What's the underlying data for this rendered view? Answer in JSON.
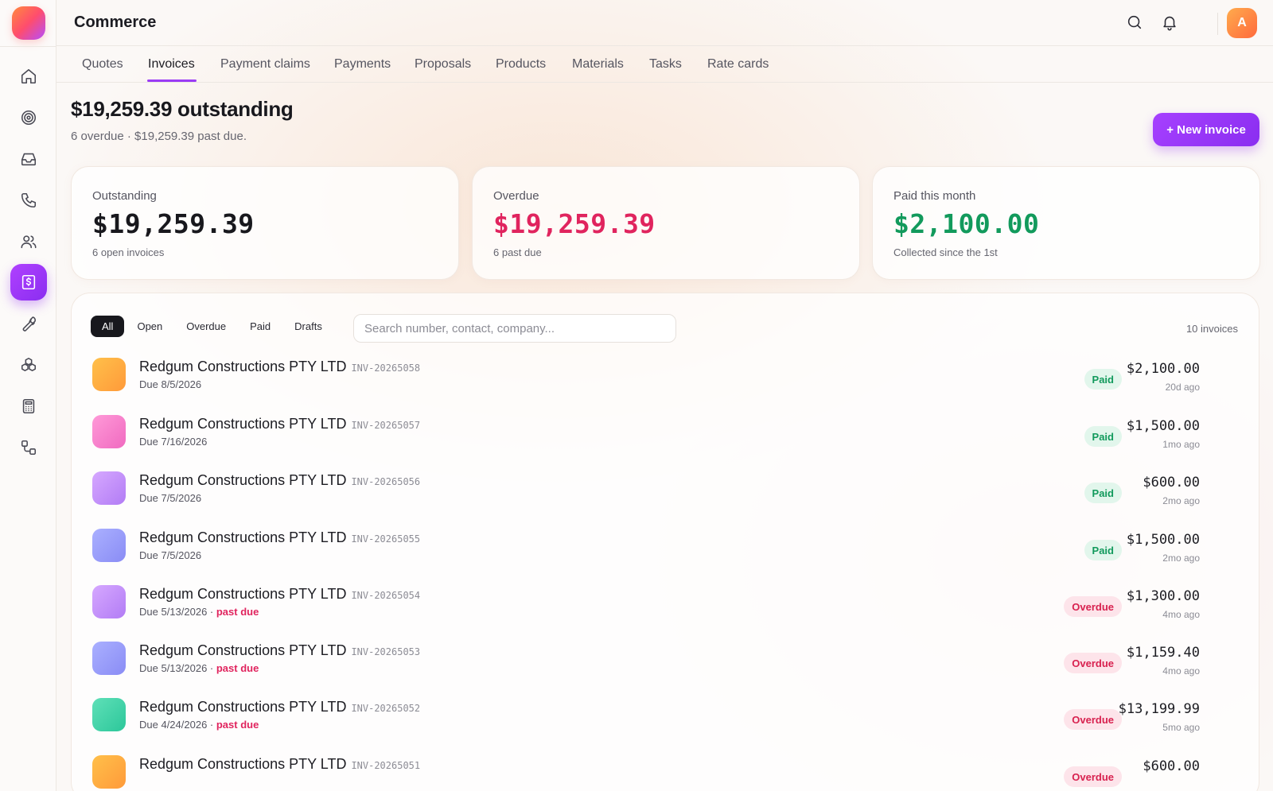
{
  "app": {
    "title": "Commerce",
    "avatar_initial": "A"
  },
  "tabs": [
    {
      "label": "Quotes"
    },
    {
      "label": "Invoices"
    },
    {
      "label": "Payment claims"
    },
    {
      "label": "Payments"
    },
    {
      "label": "Proposals"
    },
    {
      "label": "Products"
    },
    {
      "label": "Materials"
    },
    {
      "label": "Tasks"
    },
    {
      "label": "Rate cards"
    }
  ],
  "header": {
    "headline": "$19,259.39 outstanding",
    "subline": "6 overdue · $19,259.39 past due.",
    "new_button": "+ New invoice"
  },
  "stats": [
    {
      "label": "Outstanding",
      "value": "$19,259.39",
      "note": "6 open invoices",
      "color": "#18181d"
    },
    {
      "label": "Overdue",
      "value": "$19,259.39",
      "note": "6 past due",
      "color": "#e0245e"
    },
    {
      "label": "Paid this month",
      "value": "$2,100.00",
      "note": "Collected since the 1st",
      "color": "#129a5c"
    }
  ],
  "filters": [
    {
      "label": "All"
    },
    {
      "label": "Open"
    },
    {
      "label": "Overdue"
    },
    {
      "label": "Paid"
    },
    {
      "label": "Drafts"
    }
  ],
  "search": {
    "placeholder": "Search number, contact, company..."
  },
  "count_label": "10 invoices",
  "past_due_label": "past due",
  "invoices": [
    {
      "name": "Redgum Constructions PTY LTD",
      "number": "INV-20265058",
      "due": "Due 8/5/2026",
      "status": "Paid",
      "amount": "$2,100.00",
      "ago": "20d ago",
      "tile": [
        "#ffc04a",
        "#ff9a3a"
      ]
    },
    {
      "name": "Redgum Constructions PTY LTD",
      "number": "INV-20265057",
      "due": "Due 7/16/2026",
      "status": "Paid",
      "amount": "$1,500.00",
      "ago": "1mo ago",
      "tile": [
        "#ff9ad8",
        "#f06ac0"
      ]
    },
    {
      "name": "Redgum Constructions PTY LTD",
      "number": "INV-20265056",
      "due": "Due 7/5/2026",
      "status": "Paid",
      "amount": "$600.00",
      "ago": "2mo ago",
      "tile": [
        "#d6a8ff",
        "#b27cf5"
      ]
    },
    {
      "name": "Redgum Constructions PTY LTD",
      "number": "INV-20265055",
      "due": "Due 7/5/2026",
      "status": "Paid",
      "amount": "$1,500.00",
      "ago": "2mo ago",
      "tile": [
        "#aab0ff",
        "#8a8cf5"
      ]
    },
    {
      "name": "Redgum Constructions PTY LTD",
      "number": "INV-20265054",
      "due": "Due 5/13/2026",
      "past_due": true,
      "status": "Overdue",
      "amount": "$1,300.00",
      "ago": "4mo ago",
      "tile": [
        "#d6a8ff",
        "#b27cf5"
      ]
    },
    {
      "name": "Redgum Constructions PTY LTD",
      "number": "INV-20265053",
      "due": "Due 5/13/2026",
      "past_due": true,
      "status": "Overdue",
      "amount": "$1,159.40",
      "ago": "4mo ago",
      "tile": [
        "#aab0ff",
        "#8a8cf5"
      ]
    },
    {
      "name": "Redgum Constructions PTY LTD",
      "number": "INV-20265052",
      "due": "Due 4/24/2026",
      "past_due": true,
      "status": "Overdue",
      "amount": "$13,199.99",
      "ago": "5mo ago",
      "tile": [
        "#5fe0b8",
        "#2cc79a"
      ]
    },
    {
      "name": "Redgum Constructions PTY LTD",
      "number": "INV-20265051",
      "due": "",
      "status": "Overdue",
      "amount": "$600.00",
      "ago": "",
      "tile": [
        "#ffc04a",
        "#ff9a3a"
      ]
    }
  ]
}
